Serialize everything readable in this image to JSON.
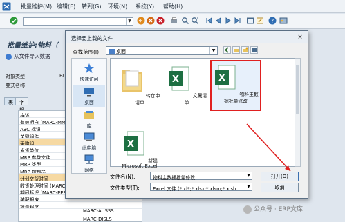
{
  "menubar": {
    "items": [
      "批量维护(M)",
      "编辑(E)",
      "转到(G)",
      "环境(N)",
      "系统(Y)",
      "帮助(H)"
    ]
  },
  "toolbar": {
    "command_placeholder": ""
  },
  "page": {
    "title": "批量维护:物料（",
    "import_button": "从文件导入数据",
    "object_type_label": "对象类型",
    "object_type_value": "BUS",
    "variant_label": "变式名称"
  },
  "tabs": [
    "表",
    "字段"
  ],
  "field_list": [
    {
      "label": "描述",
      "highlight": false
    },
    {
      "label": "有效期自 (MARC-MMST",
      "highlight": false
    },
    {
      "label": "ABC 标识",
      "highlight": false
    },
    {
      "label": "关键组件",
      "highlight": false
    },
    {
      "label": "采购组",
      "highlight": true
    },
    {
      "label": "发货单位",
      "highlight": false
    },
    {
      "label": "MRP 参数文件",
      "highlight": false
    },
    {
      "label": "MRP 类型",
      "highlight": false
    },
    {
      "label": "MRP 控制员",
      "highlight": false
    },
    {
      "label": "计划交货时间",
      "highlight": true
    },
    {
      "label": "收货处理时间 (MARC-W",
      "highlight": false
    },
    {
      "label": "期间标识 (MARC-PERKZ",
      "highlight": false
    },
    {
      "label": "装配报废",
      "highlight": false
    },
    {
      "label": "批量程序",
      "highlight": false
    }
  ],
  "field_tech": [
    "MARC-AUSSS",
    "MARC-DISLS"
  ],
  "dialog": {
    "title": "选择要上载的文件",
    "close_glyph": "×",
    "look_in_label": "查找范围(I):",
    "look_in_value": "桌面",
    "places": [
      "快速访问",
      "桌面",
      "库",
      "此电脑",
      "网络"
    ],
    "files": [
      {
        "name": "转仓申请单",
        "type": "folder",
        "selected": false
      },
      {
        "name": "文藏清单",
        "type": "excel",
        "selected": false
      },
      {
        "name": "物料主数据批量修改",
        "type": "excel",
        "selected": true
      },
      {
        "name": "新建 Microsoft Excel",
        "type": "excel",
        "selected": false
      }
    ],
    "filename_label": "文件名(N):",
    "filename_value": "物料主数据批量修改",
    "filetype_label": "文件类型(T):",
    "filetype_value": "Excel 文件 (*.xl*;*.xlsx;*.xlsm;*.xlsb",
    "open_button": "打开(O)",
    "cancel_button": "取消"
  },
  "watermark": "公众号 · ERP文库",
  "colors": {
    "accent_blue": "#3b6fb0",
    "excel_green": "#1d6f42",
    "highlight_row": "#f6d9a2",
    "annotation_red": "#e02020"
  }
}
